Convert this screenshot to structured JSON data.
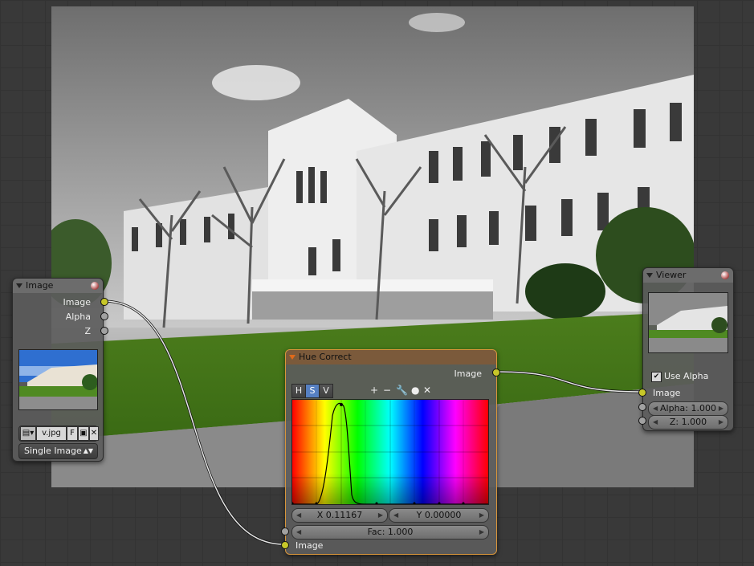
{
  "backdrop": {
    "description_icon": "photo-backdrop"
  },
  "image_node": {
    "title": "Image",
    "outputs": [
      "Image",
      "Alpha",
      "Z"
    ],
    "filename": "v.jpg",
    "fake_user_label": "F",
    "source_type": "Single Image"
  },
  "hue_node": {
    "title": "Hue Correct",
    "output": "Image",
    "tabs": [
      "H",
      "S",
      "V"
    ],
    "selected_tab": "S",
    "tools": {
      "zoom_in": "+",
      "zoom_out": "−",
      "reset": "✕"
    },
    "x_field": "X 0.11167",
    "y_field": "Y 0.00000",
    "fac_field": "Fac: 1.000",
    "input": "Image"
  },
  "viewer_node": {
    "title": "Viewer",
    "use_alpha_label": "Use Alpha",
    "use_alpha_checked": true,
    "input": "Image",
    "alpha_field": "Alpha: 1.000",
    "z_field": "Z: 1.000"
  },
  "colors": {
    "socket_color": "#c7c729",
    "socket_gray": "#a1a1a1",
    "active_border": "#d8953a",
    "selected_tab": "#5680c2"
  }
}
